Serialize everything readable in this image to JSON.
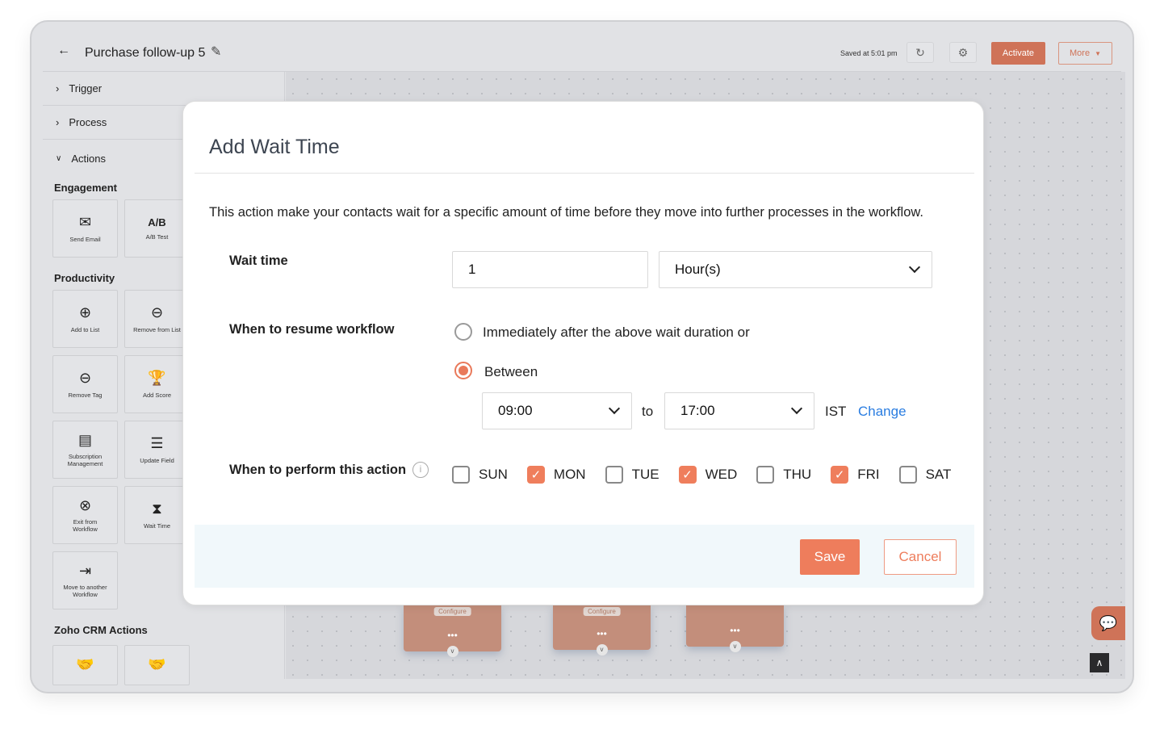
{
  "header": {
    "back_icon": "arrow-left-icon",
    "title": "Purchase follow-up 5",
    "edit_icon": "pencil-icon",
    "saved_text": "Saved at 5:01 pm",
    "refresh_icon": "refresh-icon",
    "settings_icon": "gear-icon",
    "activate_label": "Activate",
    "more_label": "More"
  },
  "sidebar": {
    "sections": [
      {
        "label": "Trigger",
        "expanded": false
      },
      {
        "label": "Process",
        "expanded": false
      },
      {
        "label": "Actions",
        "expanded": true
      }
    ],
    "engagement": {
      "heading": "Engagement",
      "tiles": [
        {
          "label": "Send Email",
          "icon": "envelope-icon"
        },
        {
          "label": "A/B Test",
          "icon_text": "A/B"
        }
      ]
    },
    "productivity": {
      "heading": "Productivity",
      "tiles": [
        {
          "label": "Add to List",
          "icon": "list-add-icon"
        },
        {
          "label": "Remove from List",
          "icon": "list-remove-icon"
        },
        {
          "label": "Remove Tag",
          "icon": "tag-remove-icon"
        },
        {
          "label": "Add Score",
          "icon": "trophy-add-icon"
        },
        {
          "label": "Subscription Management",
          "icon": "subscription-icon"
        },
        {
          "label": "Update Field",
          "icon": "update-field-icon"
        },
        {
          "label": "Exit from Workflow",
          "icon": "exit-icon"
        },
        {
          "label": "Wait Time",
          "icon": "hourglass-icon"
        },
        {
          "label": "Move to another Workflow",
          "icon": "move-workflow-icon"
        }
      ]
    },
    "crm": {
      "heading": "Zoho CRM Actions",
      "tiles": [
        {
          "icon": "handshake-icon"
        },
        {
          "icon": "handshake-check-icon"
        }
      ]
    }
  },
  "canvas": {
    "nodes": [
      {
        "configure": "Configure"
      },
      {
        "configure": "Configure"
      },
      {
        "configure": ""
      }
    ],
    "more": "•••"
  },
  "modal": {
    "title": "Add Wait Time",
    "description": "This action make your contacts wait for a specific amount of time before they move into further processes in the workflow.",
    "wait_time": {
      "label": "Wait time",
      "value": "1",
      "unit": "Hour(s)"
    },
    "resume": {
      "label": "When to resume workflow",
      "option_immediate": "Immediately after the above wait duration or",
      "option_between": "Between",
      "selected": "between",
      "from": "09:00",
      "to_label": "to",
      "to": "17:00",
      "timezone": "IST",
      "change_label": "Change"
    },
    "perform": {
      "label": "When to perform this action",
      "info_icon": "info-icon",
      "days": [
        {
          "label": "SUN",
          "checked": false
        },
        {
          "label": "MON",
          "checked": true
        },
        {
          "label": "TUE",
          "checked": false
        },
        {
          "label": "WED",
          "checked": true
        },
        {
          "label": "THU",
          "checked": false
        },
        {
          "label": "FRI",
          "checked": true
        },
        {
          "label": "SAT",
          "checked": false
        }
      ]
    },
    "save_label": "Save",
    "cancel_label": "Cancel"
  },
  "colors": {
    "accent": "#ee7d5c",
    "link": "#2a7de1"
  }
}
